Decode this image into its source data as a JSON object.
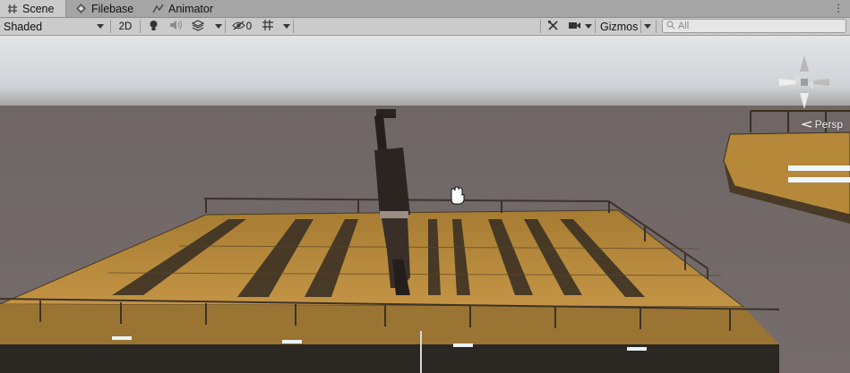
{
  "tabs": [
    {
      "label": "Scene",
      "icon": "hash-icon",
      "active": true
    },
    {
      "label": "Filebase",
      "icon": "diamond-icon",
      "active": false
    },
    {
      "label": "Animator",
      "icon": "animator-icon",
      "active": false
    }
  ],
  "toolbar": {
    "shading_mode": "Shaded",
    "mode_2d_label": "2D",
    "hidden_count": "0",
    "gizmos_label": "Gizmos",
    "search_placeholder": "All"
  },
  "viewport": {
    "projection_label": "Persp"
  },
  "colors": {
    "sky_top": "#dfe3e6",
    "ground": "#6d6464",
    "platform_wood": "#b98a3a",
    "tab_active": "#cbcbcb"
  }
}
